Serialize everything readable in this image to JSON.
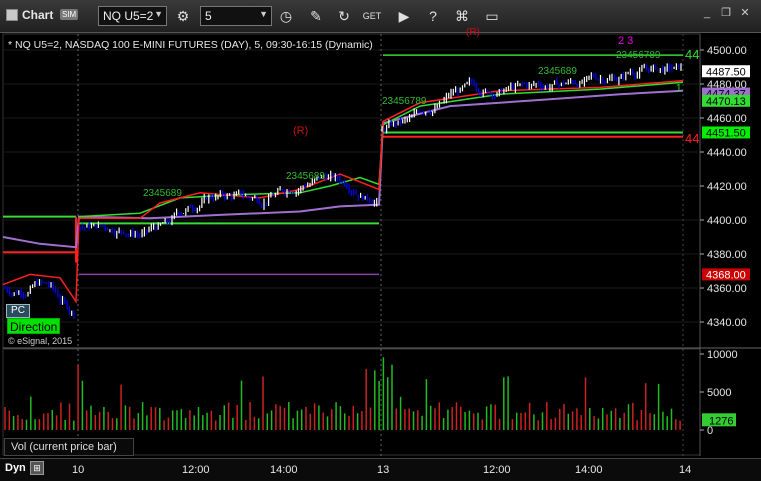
{
  "window": {
    "title": "Chart",
    "sim_badge": "SIM",
    "symbol": "NQ U5=2",
    "interval": "5"
  },
  "chart": {
    "header": "* NQ U5=2, NASDAQ 100 E-MINI FUTURES (DAY), 5, 09:30-16:15 (Dynamic)",
    "copyright": "© eSignal, 2015",
    "pc_tag": "PC",
    "direction_tag": "Direction",
    "volume_label": "Vol (current price bar)",
    "dyn_label": "Dyn",
    "price_ticks": [
      "4500.00",
      "4480.00",
      "4460.00",
      "4440.00",
      "4420.00",
      "4400.00",
      "4380.00",
      "4360.00",
      "4340.00"
    ],
    "volume_ticks": [
      "10000",
      "5000",
      "0"
    ],
    "time_ticks": [
      "10",
      "12:00",
      "14:00",
      "13",
      "12:00",
      "14:00",
      "14"
    ],
    "price_badges": [
      {
        "label": "4487.50",
        "color": "#ffffff",
        "text_color": "#000000"
      },
      {
        "label": "4474.37",
        "color": "#a070d0",
        "text_color": "#000000"
      },
      {
        "label": "4470.13",
        "color": "#33dd33",
        "text_color": "#000000"
      },
      {
        "label": "4451.50",
        "color": "#00ee00",
        "text_color": "#000000"
      },
      {
        "label": "4368.00",
        "color": "#cc0000",
        "text_color": "#ffffff"
      }
    ],
    "volume_badge": "1276",
    "annotations": {
      "r_label": "(R)",
      "r_top": "(R)",
      "level_44_top": "44",
      "level_44_red": "44",
      "seq1": "2345689",
      "seq2": "2345689",
      "seq3": "23456789",
      "seq4": "2345689",
      "seq5": "23456789",
      "magenta_nums": "2 3",
      "small_1": "1"
    },
    "colors": {
      "up_bar": "#ffffff",
      "down_bar": "#0000ff",
      "red_line": "#ff2020",
      "green_line": "#33dd33",
      "purple_line": "#a070d0",
      "volume_red": "#cc2222",
      "volume_green": "#22bb22"
    }
  },
  "icons": [
    "window-icon",
    "settings-icon",
    "clock-icon",
    "pencil-icon",
    "refresh-icon",
    "get-icon",
    "play-icon",
    "question-icon",
    "tag-icon",
    "speech-icon",
    "minimize-icon",
    "restore-icon",
    "close-icon"
  ]
}
